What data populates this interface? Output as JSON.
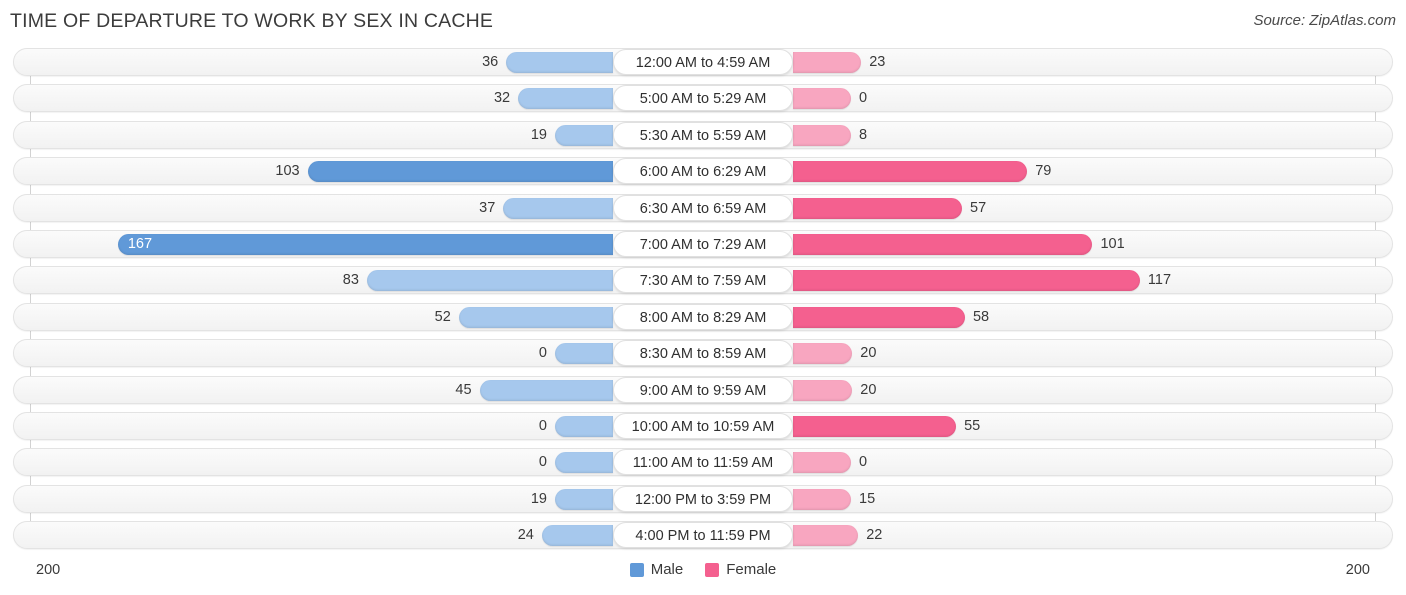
{
  "header": {
    "title": "TIME OF DEPARTURE TO WORK BY SEX IN CACHE",
    "source": "Source: ZipAtlas.com"
  },
  "legend": {
    "male_label": "Male",
    "female_label": "Female",
    "male_color": "#6099d8",
    "female_color": "#f4608f"
  },
  "axis": {
    "left_max": "200",
    "right_max": "200",
    "max_value": 200
  },
  "colors": {
    "male_light": "#a6c8ed",
    "male_strong": "#6099d8",
    "female_light": "#f8a6c0",
    "female_strong": "#f4608f",
    "track": "#f4f4f4"
  },
  "chart_data": {
    "type": "bar",
    "orientation": "horizontal",
    "layout": "diverging-bidirectional",
    "title": "TIME OF DEPARTURE TO WORK BY SEX IN CACHE",
    "xlabel": "",
    "ylabel": "",
    "xlim": [
      0,
      200
    ],
    "grid": false,
    "legend_position": "bottom-center",
    "categories": [
      "12:00 AM to 4:59 AM",
      "5:00 AM to 5:29 AM",
      "5:30 AM to 5:59 AM",
      "6:00 AM to 6:29 AM",
      "6:30 AM to 6:59 AM",
      "7:00 AM to 7:29 AM",
      "7:30 AM to 7:59 AM",
      "8:00 AM to 8:29 AM",
      "8:30 AM to 8:59 AM",
      "9:00 AM to 9:59 AM",
      "10:00 AM to 10:59 AM",
      "11:00 AM to 11:59 AM",
      "12:00 PM to 3:59 PM",
      "4:00 PM to 11:59 PM"
    ],
    "series": [
      {
        "name": "Male",
        "color": "#6099d8",
        "values": [
          36,
          32,
          19,
          103,
          37,
          167,
          83,
          52,
          0,
          45,
          0,
          0,
          19,
          24
        ]
      },
      {
        "name": "Female",
        "color": "#f4608f",
        "values": [
          23,
          0,
          8,
          79,
          57,
          101,
          117,
          58,
          20,
          20,
          55,
          0,
          15,
          22
        ]
      }
    ]
  }
}
